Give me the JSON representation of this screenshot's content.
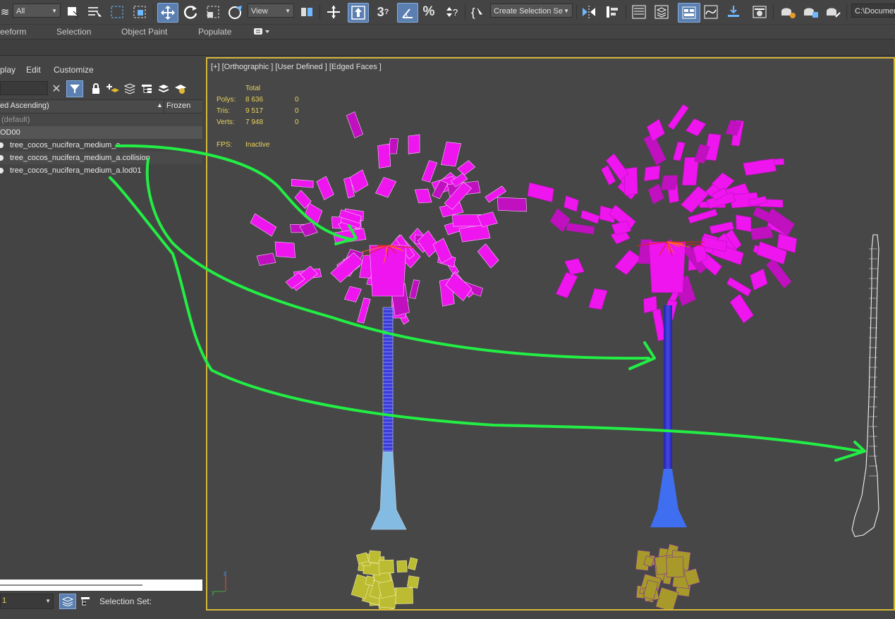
{
  "toolbar": {
    "filter_value": "All",
    "ref_coord_value": "View",
    "named_selection_value": "Create Selection Se",
    "path_value": "C:\\Documen",
    "icons": [
      "move-icon",
      "rotate-icon",
      "scale-icon",
      "select-object-icon",
      "select-by-name-icon",
      "rectangle-select-icon",
      "window-crossing-icon",
      "pivot-icon",
      "select-manipulate-icon",
      "snap-3d-icon",
      "angle-snap-icon",
      "percent-snap-icon",
      "spinner-snap-icon",
      "edit-named-selection-icon",
      "mirror-icon",
      "align-icon",
      "scene-explorer-icon",
      "layer-explorer-icon",
      "toggle-ribbon-icon",
      "curve-editor-icon",
      "schematic-view-icon",
      "material-editor-icon",
      "render-setup-icon",
      "rendered-frame-icon",
      "render-icon"
    ]
  },
  "ribbon": {
    "tabs": [
      "eeform",
      "Selection",
      "Object Paint",
      "Populate"
    ]
  },
  "explorer": {
    "menu": [
      "play",
      "Edit",
      "Customize"
    ],
    "col_sort": "ed Ascending)",
    "col_frozen": "Frozen",
    "rows": [
      {
        "label": "(default)"
      },
      {
        "label": "OD00"
      },
      {
        "label": "tree_cocos_nucifera_medium_a"
      },
      {
        "label": "tree_cocos_nucifera_medium_a.collision"
      },
      {
        "label": "tree_cocos_nucifera_medium_a.lod01"
      }
    ],
    "bottom": {
      "layer_value": "1",
      "selection_set_label": "Selection Set:"
    }
  },
  "viewport": {
    "label": "[+] [Orthographic ] [User Defined ] [Edged Faces ]",
    "stats": {
      "header": "Total",
      "polys_label": "Polys:",
      "polys_total": "8 636",
      "polys_sel": "0",
      "tris_label": "Tris:",
      "tris_total": "9 517",
      "tris_sel": "0",
      "verts_label": "Verts:",
      "verts_total": "7 948",
      "verts_sel": "0",
      "fps_label": "FPS:",
      "fps_value": "Inactive"
    },
    "axis_z": "z",
    "axis_x": "x",
    "axis_y": "y"
  },
  "colors": {
    "palm_leaves": "#ee15ee",
    "trunk_blue": "#3a3fd0",
    "trunk_wire": "#3b6bff",
    "root_yellow": "#bcbc32",
    "annotation_green": "#22ee44",
    "viewport_border": "#d6b73a",
    "stats_yellow": "#e8d25a"
  }
}
